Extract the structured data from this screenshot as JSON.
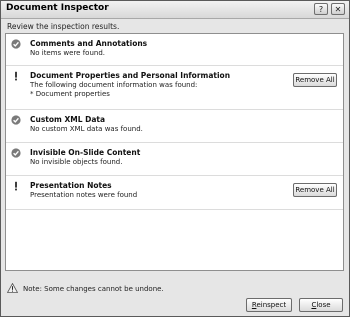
{
  "window": {
    "title": "Document Inspector",
    "help_glyph": "?",
    "close_glyph": "✕"
  },
  "instruction": "Review the inspection results.",
  "results": [
    {
      "status": "ok",
      "icon": "check-circle-icon",
      "title": "Comments and Annotations",
      "description": [
        "No items were found."
      ]
    },
    {
      "status": "found",
      "icon": "exclamation-icon",
      "title": "Document Properties and Personal Information",
      "description": [
        "The following document information was found:",
        "* Document properties"
      ],
      "button": "Remove All"
    },
    {
      "status": "ok",
      "icon": "check-circle-icon",
      "title": "Custom XML Data",
      "description": [
        "No custom XML data was found."
      ]
    },
    {
      "status": "ok",
      "icon": "check-circle-icon",
      "title": "Invisible On-Slide Content",
      "description": [
        "No invisible objects found."
      ]
    },
    {
      "status": "found",
      "icon": "exclamation-icon",
      "title": "Presentation Notes",
      "description": [
        "Presentation notes were found"
      ],
      "button": "Remove All"
    }
  ],
  "footer": {
    "note": "Note: Some changes cannot be undone.",
    "reinspect_label": "Reinspect",
    "reinspect_mnemonic": "R",
    "reinspect_rest": "einspect",
    "close_label": "Close",
    "close_mnemonic": "C",
    "close_rest": "lose"
  },
  "colors": {
    "check": "#7a7a7a",
    "warning": "#2a2a2a",
    "panel_bg": "#ffffff",
    "dialog_bg": "#e6e6e6"
  }
}
